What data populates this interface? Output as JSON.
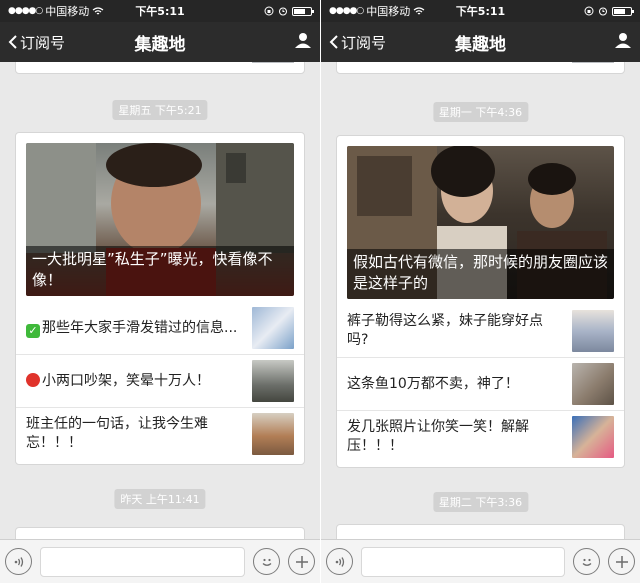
{
  "status_bar": {
    "carrier": "中国移动",
    "time": "下午5:11",
    "battery_level": 0.6
  },
  "nav": {
    "back_label": "订阅号",
    "title": "集趣地"
  },
  "left_feed": {
    "timestamp_1": "星期五 下午5:21",
    "hero_caption": "一大批明星”私生子”曝光，快看像不像！",
    "items": [
      {
        "text": "那些年大家手滑发错过的信息...",
        "icon": "check-emoji"
      },
      {
        "text": "小两口吵架，笑晕十万人！",
        "icon": "red-circle-emoji"
      },
      {
        "text": "班主任的一句话，让我今生难忘！！！",
        "icon": ""
      }
    ],
    "timestamp_2": "昨天 上午11:41"
  },
  "right_feed": {
    "timestamp_1": "星期一 下午4:36",
    "hero_caption": "假如古代有微信，那时候的朋友圈应该是这样子的",
    "items": [
      {
        "text": "裤子勒得这么紧，妹子能穿好点吗?"
      },
      {
        "text": "这条鱼10万都不卖，神了！"
      },
      {
        "text": "发几张照片让你笑一笑！解解压！！！"
      }
    ],
    "timestamp_2": "星期二 下午3:36"
  },
  "colors": {
    "status_bg": "#262626",
    "nav_bg": "#2c2c2c",
    "feed_bg": "#e9e9e9",
    "chip_bg": "#d2d2d2"
  },
  "icons": {
    "back": "chevron-left-icon",
    "profile": "person-icon",
    "voice": "voice-icon",
    "emoji": "smiley-icon",
    "add": "plus-icon"
  }
}
